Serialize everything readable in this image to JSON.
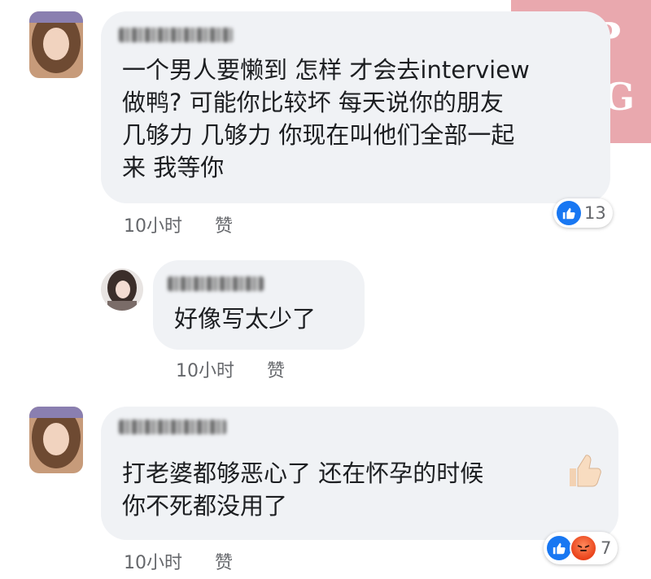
{
  "watermark": {
    "line1": "ToP",
    "line2": "FenG"
  },
  "comments": [
    {
      "text": "一个男人要懒到 怎样 才会去interview\n做鸭? 可能你比较坏 每天说你的朋友\n几够力 几够力 你现在叫他们全部一起\n来 我等你",
      "time": "10小时",
      "like_label": "赞",
      "reaction_count": "13"
    },
    {
      "text": "好像写太少了",
      "time": "10小时",
      "like_label": "赞"
    },
    {
      "text": "打老婆都够恶心了 还在怀孕的时候\n你不死都没用了",
      "time": "10小时",
      "like_label": "赞",
      "reaction_count": "7"
    }
  ],
  "colors": {
    "like_blue": "#1877f2",
    "bubble": "#f0f2f5",
    "meta_gray": "#65676b"
  }
}
